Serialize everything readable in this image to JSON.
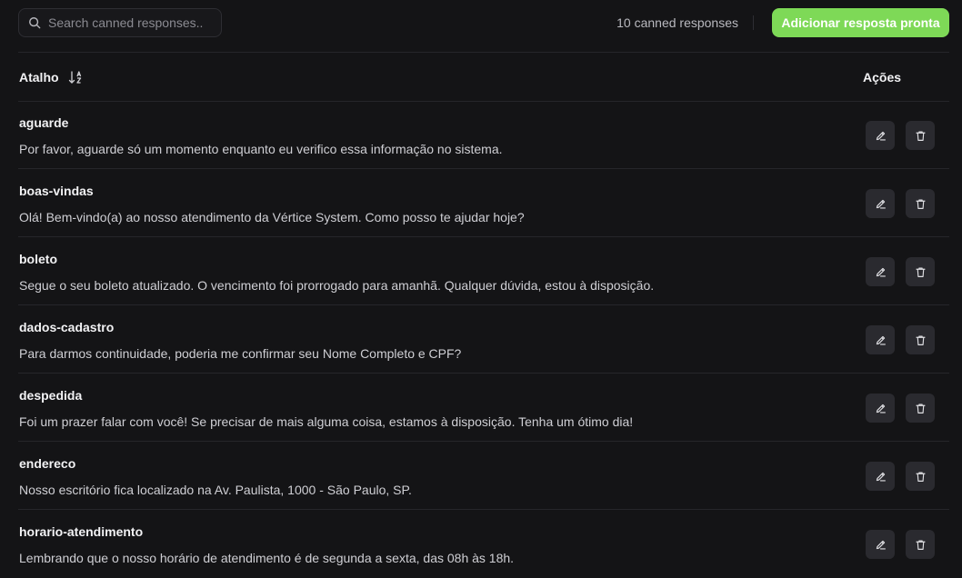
{
  "search": {
    "placeholder": "Search canned responses.."
  },
  "header": {
    "count_label": "10 canned responses",
    "add_button": "Adicionar resposta pronta"
  },
  "table": {
    "col_shortcut": "Atalho",
    "col_actions": "Ações",
    "rows": [
      {
        "shortcut": "aguarde",
        "content": "Por favor, aguarde só um momento enquanto eu verifico essa informação no sistema."
      },
      {
        "shortcut": "boas-vindas",
        "content": "Olá! Bem-vindo(a) ao nosso atendimento da Vértice System. Como posso te ajudar hoje?"
      },
      {
        "shortcut": "boleto",
        "content": "Segue o seu boleto atualizado. O vencimento foi prorrogado para amanhã. Qualquer dúvida, estou à disposição."
      },
      {
        "shortcut": "dados-cadastro",
        "content": "Para darmos continuidade, poderia me confirmar seu Nome Completo e CPF?"
      },
      {
        "shortcut": "despedida",
        "content": "Foi um prazer falar com você! Se precisar de mais alguma coisa, estamos à disposição. Tenha um ótimo dia!"
      },
      {
        "shortcut": "endereco",
        "content": "Nosso escritório fica localizado na Av. Paulista, 1000 - São Paulo, SP."
      },
      {
        "shortcut": "horario-atendimento",
        "content": "Lembrando que o nosso horário de atendimento é de segunda a sexta, das 08h às 18h."
      }
    ]
  },
  "icons": {
    "search": "search-icon",
    "sort": "sort-alpha-icon",
    "edit": "pencil-icon",
    "delete": "trash-icon"
  },
  "colors": {
    "background": "#141416",
    "accent": "#7ed957",
    "action_button": "#2a2a2f"
  }
}
